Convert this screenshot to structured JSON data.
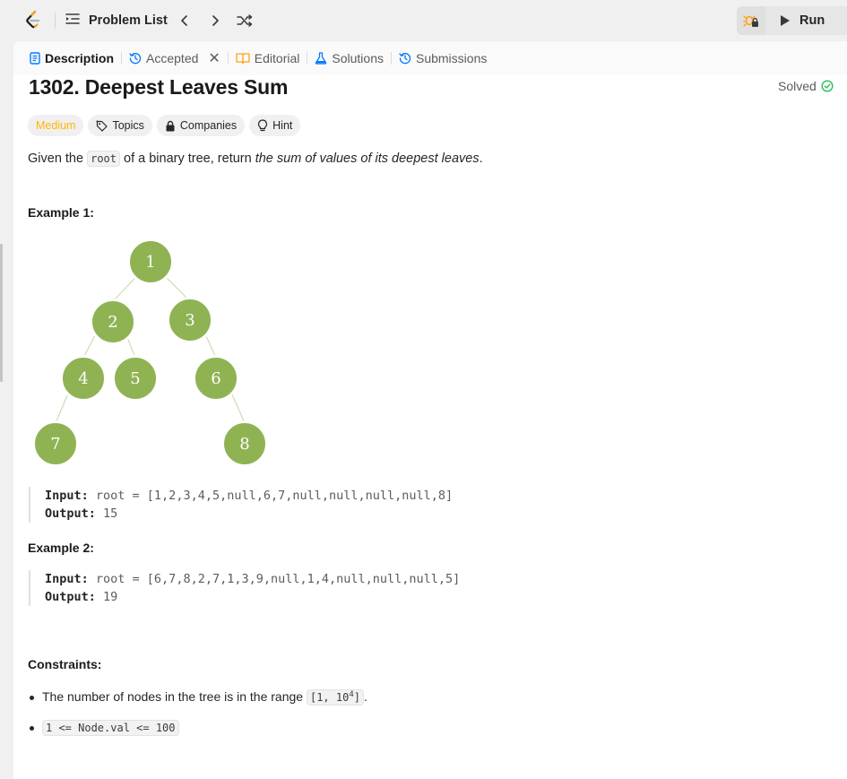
{
  "navbar": {
    "problem_list_label": "Problem List",
    "run_label": "Run"
  },
  "tabs": [
    {
      "label": "Description",
      "icon": "description-icon",
      "active": true
    },
    {
      "label": "Accepted",
      "icon": "history-icon",
      "closable": true
    },
    {
      "label": "Editorial",
      "icon": "book-icon"
    },
    {
      "label": "Solutions",
      "icon": "flask-icon"
    },
    {
      "label": "Submissions",
      "icon": "history-icon"
    }
  ],
  "problem": {
    "title": "1302. Deepest Leaves Sum",
    "status": "Solved",
    "difficulty": "Medium",
    "tags": [
      "Topics",
      "Companies",
      "Hint"
    ],
    "description": {
      "pre": "Given the ",
      "code": "root",
      "mid": " of a binary tree, return ",
      "em": "the sum of values of its deepest leaves",
      "post": "."
    }
  },
  "example1": {
    "heading": "Example 1:",
    "tree_nodes": [
      "1",
      "2",
      "3",
      "4",
      "5",
      "6",
      "7",
      "8"
    ],
    "input_label": "Input:",
    "input_value": " root = [1,2,3,4,5,null,6,7,null,null,null,null,8]",
    "output_label": "Output:",
    "output_value": " 15"
  },
  "example2": {
    "heading": "Example 2:",
    "input_label": "Input:",
    "input_value": " root = [6,7,8,2,7,1,3,9,null,1,4,null,null,null,5]",
    "output_label": "Output:",
    "output_value": " 19"
  },
  "constraints": {
    "heading": "Constraints:",
    "c1_text": "The number of nodes in the tree is in the range ",
    "c1_code_pre": "[1, 10",
    "c1_code_sup": "4",
    "c1_code_post": "]",
    "c1_end": ".",
    "c2_code": "1 <= Node.val <= 100"
  },
  "colors": {
    "medium": "#ffb700",
    "solved": "#2cbb5d",
    "tree_node": "#8fb353",
    "tab_icon_description": "#007aff"
  }
}
